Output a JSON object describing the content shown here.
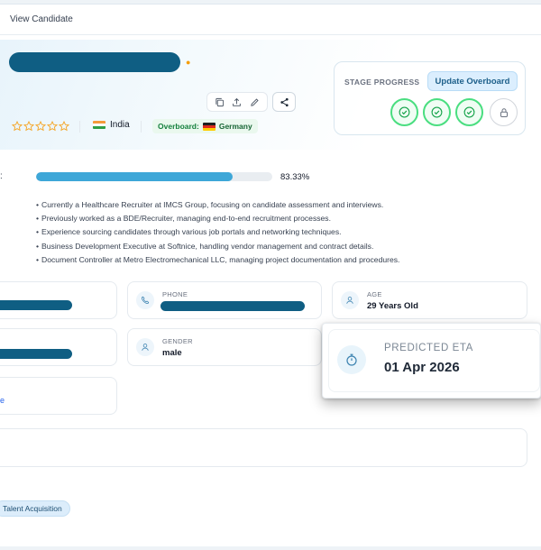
{
  "topbar": {
    "title": "View Candidate"
  },
  "profile": {
    "name_redacted": true,
    "rating": {
      "value": 0,
      "max": 5
    },
    "country": "India",
    "overboard_label": "Overboard:",
    "overboard_country": "Germany"
  },
  "stage": {
    "label": "STAGE PROGRESS",
    "update_button": "Update Overboard",
    "steps": [
      {
        "state": "complete",
        "icon": "check-circle-icon"
      },
      {
        "state": "complete",
        "icon": "check-circle-icon"
      },
      {
        "state": "complete",
        "icon": "check-circle-icon"
      },
      {
        "state": "locked",
        "icon": "lock-icon"
      }
    ]
  },
  "progress": {
    "label": ":",
    "fraction": 0.8333,
    "text": "83.33%"
  },
  "summary": [
    "Currently a Healthcare Recruiter at IMCS Group, focusing on candidate assessment and interviews.",
    "Previously worked as a BDE/Recruiter, managing end-to-end recruitment processes.",
    "Experience sourcing candidates through various job portals and networking techniques.",
    "Business Development Executive at Softnice, handling vendor management and contract details.",
    "Document Controller at Metro Electromechanical LLC, managing project documentation and procedures."
  ],
  "fields": {
    "phone": {
      "label": "PHONE",
      "redacted": true
    },
    "age": {
      "label": "AGE",
      "value": "29 Years Old"
    },
    "gender": {
      "label": "GENDER",
      "value": "male"
    }
  },
  "link_fragment": "e",
  "eta": {
    "label": "PREDICTED ETA",
    "value": "01 Apr 2026"
  },
  "tag": "Talent Acquisition",
  "colors": {
    "accent": "#3ea7d8",
    "brand_dark": "#0f5e83",
    "success": "#4ade80"
  }
}
